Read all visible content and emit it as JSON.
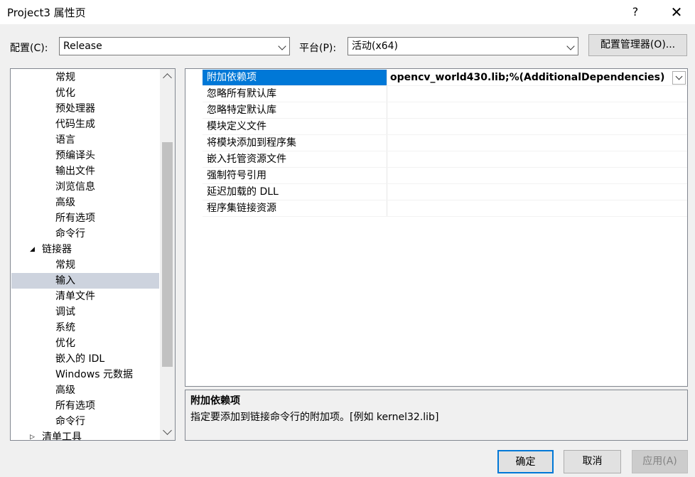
{
  "window": {
    "title": "Project3 属性页",
    "help_label": "?",
    "close_label": "✕"
  },
  "config": {
    "config_label": "配置(C):",
    "config_value": "Release",
    "platform_label": "平台(P):",
    "platform_value": "活动(x64)",
    "manager_label": "配置管理器(O)..."
  },
  "tree": {
    "items": [
      {
        "label": "常规"
      },
      {
        "label": "优化"
      },
      {
        "label": "预处理器"
      },
      {
        "label": "代码生成"
      },
      {
        "label": "语言"
      },
      {
        "label": "预编译头"
      },
      {
        "label": "输出文件"
      },
      {
        "label": "浏览信息"
      },
      {
        "label": "高级"
      },
      {
        "label": "所有选项"
      },
      {
        "label": "命令行"
      },
      {
        "label": "链接器",
        "expander": "◢"
      },
      {
        "label": "常规"
      },
      {
        "label": "输入"
      },
      {
        "label": "清单文件"
      },
      {
        "label": "调试"
      },
      {
        "label": "系统"
      },
      {
        "label": "优化"
      },
      {
        "label": "嵌入的 IDL"
      },
      {
        "label": "Windows 元数据"
      },
      {
        "label": "高级"
      },
      {
        "label": "所有选项"
      },
      {
        "label": "命令行"
      },
      {
        "label": "清单工具",
        "expander": "▷"
      }
    ],
    "selected_index": 13
  },
  "grid": {
    "rows": [
      {
        "name": "附加依赖项",
        "value": "opencv_world430.lib;%(AdditionalDependencies)"
      },
      {
        "name": "忽略所有默认库",
        "value": ""
      },
      {
        "name": "忽略特定默认库",
        "value": ""
      },
      {
        "name": "模块定义文件",
        "value": ""
      },
      {
        "name": "将模块添加到程序集",
        "value": ""
      },
      {
        "name": "嵌入托管资源文件",
        "value": ""
      },
      {
        "name": "强制符号引用",
        "value": ""
      },
      {
        "name": "延迟加载的 DLL",
        "value": ""
      },
      {
        "name": "程序集链接资源",
        "value": ""
      }
    ],
    "selected_index": 0
  },
  "description": {
    "title": "附加依赖项",
    "text": "指定要添加到链接命令行的附加项。[例如 kernel32.lib]"
  },
  "buttons": {
    "ok": "确定",
    "cancel": "取消",
    "apply": "应用(A)"
  },
  "colors": {
    "grid_selected": "#0078d7",
    "tree_selected": "#cdd3de",
    "ok_border": "#0078d7"
  }
}
